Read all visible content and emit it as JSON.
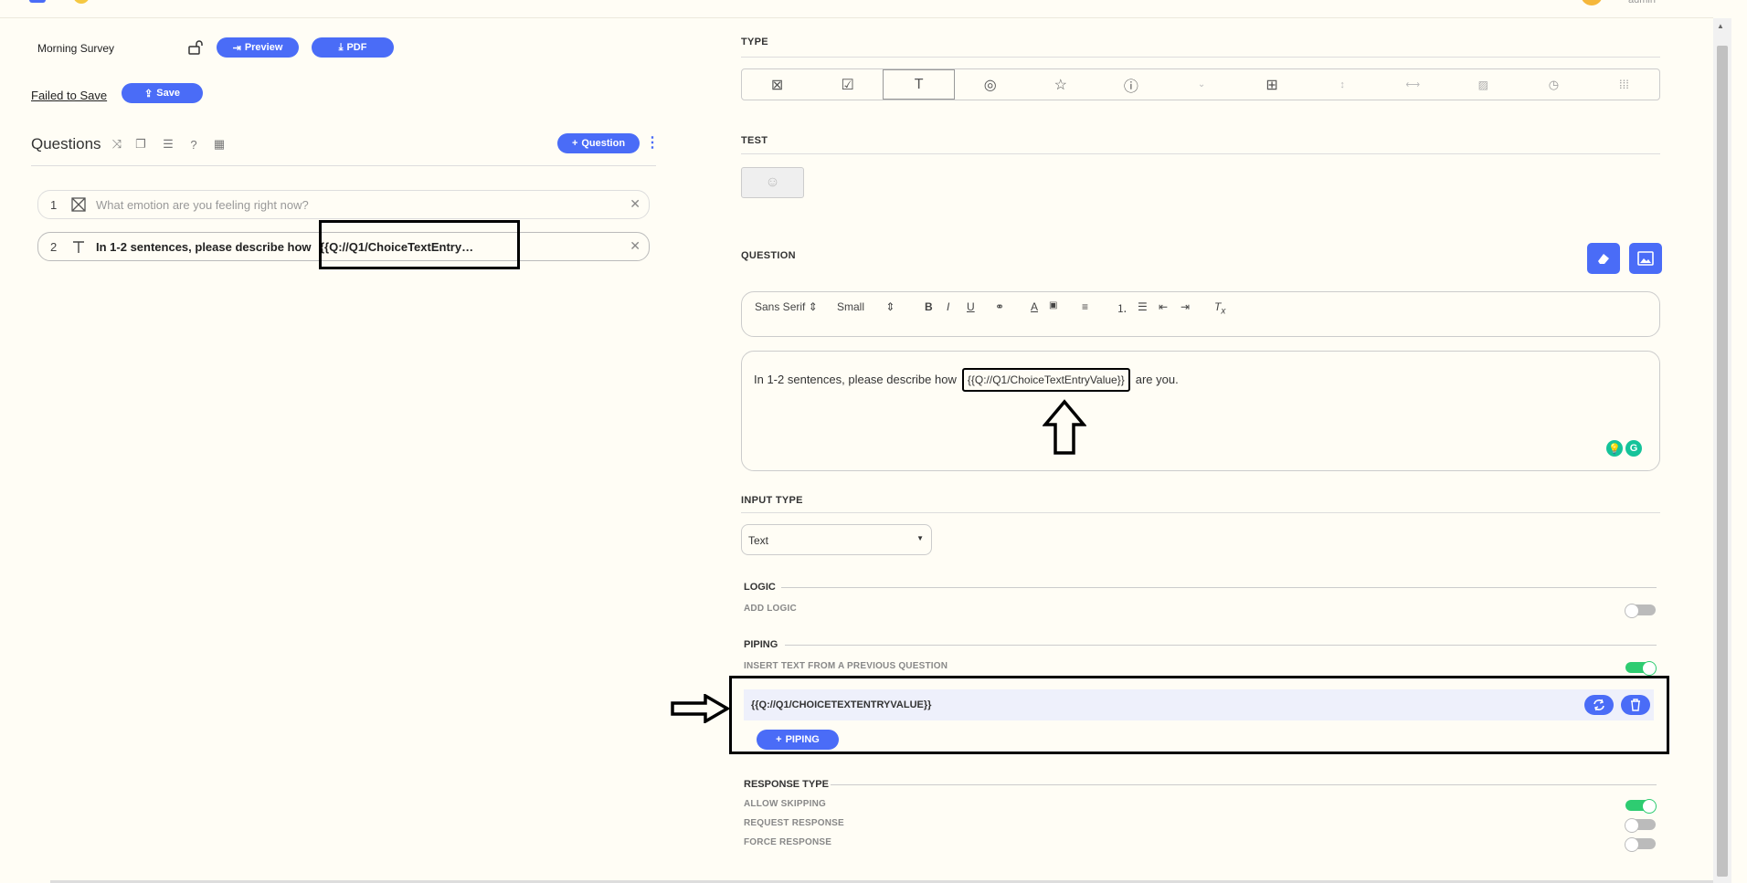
{
  "header": {
    "user_name": "admin"
  },
  "survey": {
    "title": "Morning Survey",
    "preview_label": "Preview",
    "pdf_label": "PDF",
    "failed_label": "Failed to Save",
    "save_label": "Save"
  },
  "questions_panel": {
    "title": "Questions",
    "add_label": "Question",
    "items": [
      {
        "num": "1",
        "icon": "checkbox-x-icon",
        "text": "What emotion are you feeling right now?"
      },
      {
        "num": "2",
        "icon": "text-t-icon",
        "text": "In 1-2 sentences, please describe how",
        "pipe": "{{Q://Q1/ChoiceTextEntry…"
      }
    ]
  },
  "editor": {
    "type_label": "TYPE",
    "test_label": "TEST",
    "question_label": "QUESTION",
    "toolbar": {
      "font": "Sans Serif",
      "size": "Small"
    },
    "content": {
      "before": "In 1-2 sentences, please describe how",
      "pipe": "{{Q://Q1/ChoiceTextEntryValue}}",
      "after": "are you."
    },
    "input_type_label": "INPUT TYPE",
    "input_type_value": "Text",
    "logic": {
      "label": "LOGIC",
      "add_logic": "ADD LOGIC",
      "enabled": false
    },
    "piping": {
      "label": "PIPING",
      "insert_text": "INSERT TEXT FROM A PREVIOUS QUESTION",
      "enabled": true,
      "value": "{{Q://Q1/CHOICETEXTENTRYVALUE}}",
      "add_label": "PIPING"
    },
    "response_type": {
      "label": "RESPONSE TYPE",
      "options": [
        {
          "label": "ALLOW SKIPPING",
          "enabled": true
        },
        {
          "label": "REQUEST RESPONSE",
          "enabled": false
        },
        {
          "label": "FORCE RESPONSE",
          "enabled": false
        }
      ]
    }
  },
  "colors": {
    "accent": "#4a6cf7",
    "toggle_on": "#2ecc71",
    "background": "#fffdf5"
  }
}
